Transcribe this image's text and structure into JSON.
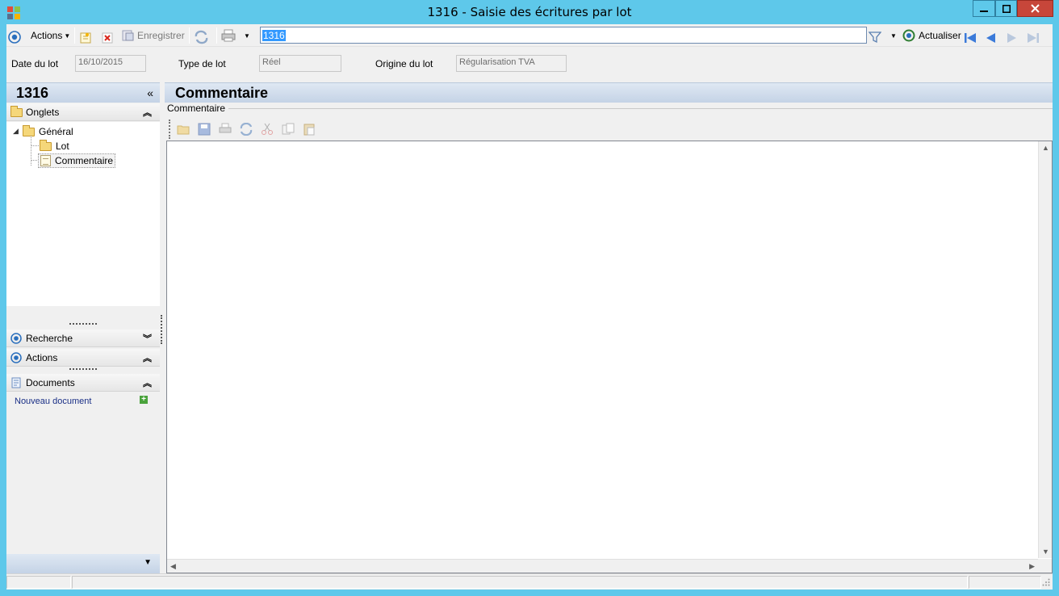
{
  "window": {
    "title": "1316 -  Saisie des écritures par lot",
    "controls": [
      "minimize-icon",
      "maximize-icon",
      "close-icon"
    ]
  },
  "toolbar": {
    "actions_label": "Actions",
    "save_label": "Enregistrer",
    "search_value": "1316",
    "refresh_label": "Actualiser"
  },
  "header_fields": {
    "date_label": "Date du lot",
    "date_value": "16/10/2015",
    "type_label": "Type de lot",
    "type_value": "Réel",
    "origin_label": "Origine du lot",
    "origin_value": "Régularisation TVA"
  },
  "left_panel": {
    "title": "1316",
    "collapse_glyph": "«",
    "onglets_label": "Onglets",
    "tree": {
      "root": "Général",
      "children": [
        "Lot",
        "Commentaire"
      ]
    },
    "recherche_label": "Recherche",
    "actions_label": "Actions",
    "documents_label": "Documents",
    "new_document_label": "Nouveau document"
  },
  "main": {
    "title": "Commentaire",
    "group_label": "Commentaire"
  },
  "colors": {
    "titlebar": "#5ec8ea",
    "close_button": "#c7463a",
    "header_gradient_top": "#dfe8f3",
    "header_gradient_bottom": "#c4d3e6",
    "link": "#1a2f86",
    "selection": "#3399ff"
  }
}
